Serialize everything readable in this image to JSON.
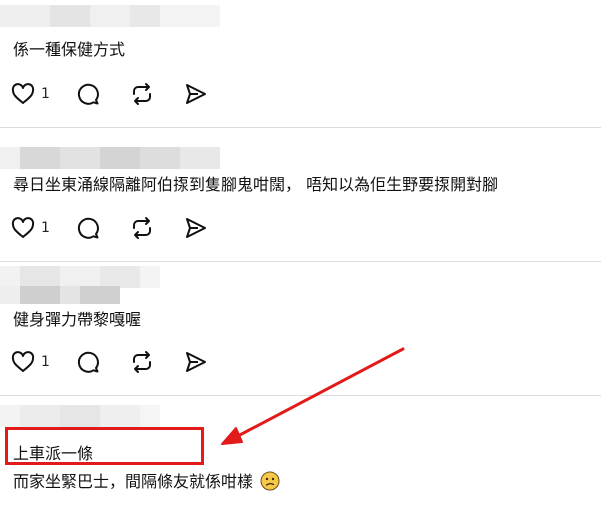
{
  "posts": [
    {
      "text": "係一種保健方式",
      "likes": "1"
    },
    {
      "text": "尋日坐東涌線隔離阿伯揼到隻腳鬼咁闊，  唔知以為佢生野要揼開對腳",
      "likes": "1"
    },
    {
      "text": "健身彈力帶黎嘎喔",
      "likes": "1"
    },
    {
      "text": "上車派一條",
      "text2": "而家坐緊巴士，間隔條友就係咁樣"
    }
  ],
  "icons": [
    "heart-icon",
    "comment-icon",
    "repost-icon",
    "share-icon",
    "confused-face-emoji"
  ],
  "annotation_color": "#e21a1a"
}
